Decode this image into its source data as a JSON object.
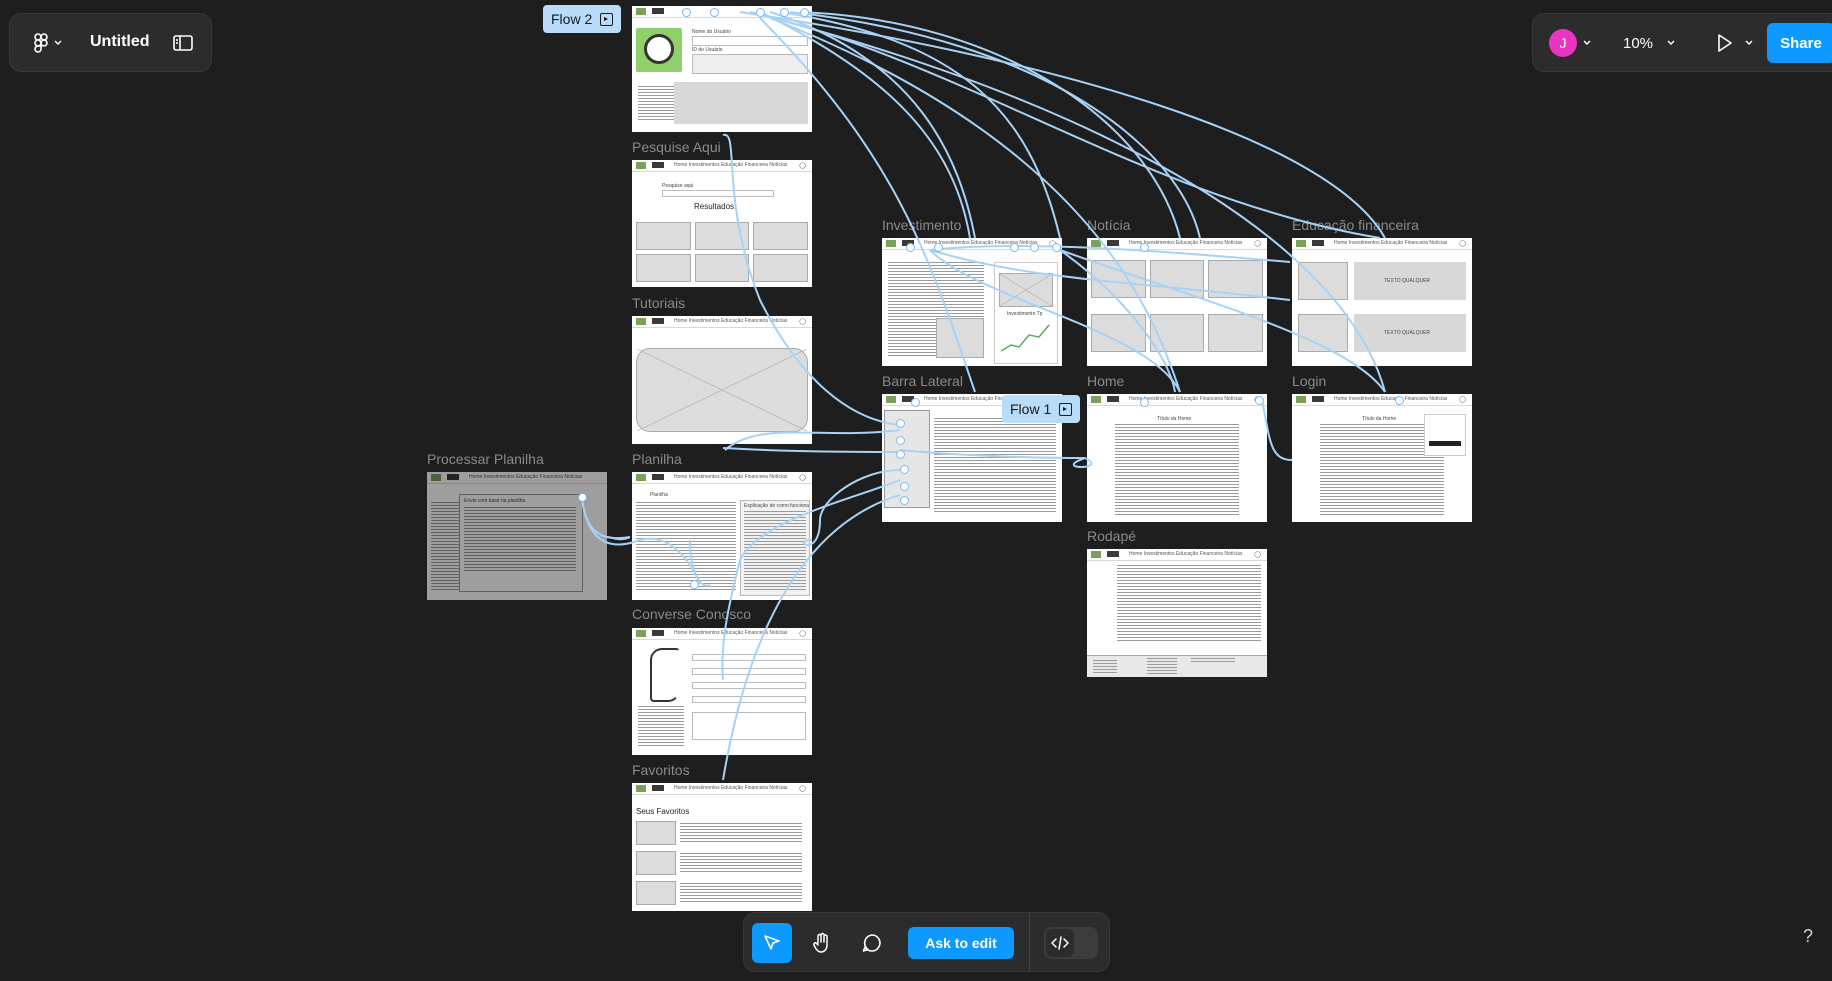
{
  "file": {
    "title": "Untitled"
  },
  "toolbar": {
    "zoom": "10%",
    "share_label": "Share",
    "avatar_initial": "J",
    "avatar_color": "#e935c1",
    "accent": "#0d99ff"
  },
  "bottom_bar": {
    "ask_label": "Ask to edit"
  },
  "help_label": "?",
  "flows": {
    "flow2": "Flow 2",
    "flow1": "Flow 1"
  },
  "frame_titles": {
    "pesquise": "Pesquise Aqui",
    "tutoriais": "Tutoriais",
    "planilha": "Planilha",
    "processar": "Processar Planilha",
    "converse": "Converse Conosco",
    "favoritos": "Favoritos",
    "investimento": "Investimento",
    "noticia": "Notícia",
    "educacao": "Educação financeira",
    "barra": "Barra Lateral",
    "home": "Home",
    "login": "Login",
    "rodape": "Rodapé"
  },
  "wire_text": {
    "nav_links": "Home  Investimentos  Educação Financeira  Notícias",
    "resultados": "Resultados:",
    "pesquise_aqui": "Pesquise aqui",
    "seus_favoritos": "Seus Favoritos",
    "texto_qualquer": "TEXTO QUALQUER",
    "titulo_home": "Título da Home",
    "planilha": "Planilha",
    "explicacao": "Explicação de como funciona",
    "nome_usuario": "Nome do Usuário",
    "id_usuario": "ID do Usuário",
    "processar_title": "Envio com base na planilha",
    "titulo_noticia": "Título da notícia",
    "investimento_tp": "Investimento Tp"
  },
  "colors": {
    "canvas": "#1e1e1e",
    "panel": "#2c2c2c",
    "flow": "#a8d2f5",
    "chip": "#b9dcfa"
  }
}
